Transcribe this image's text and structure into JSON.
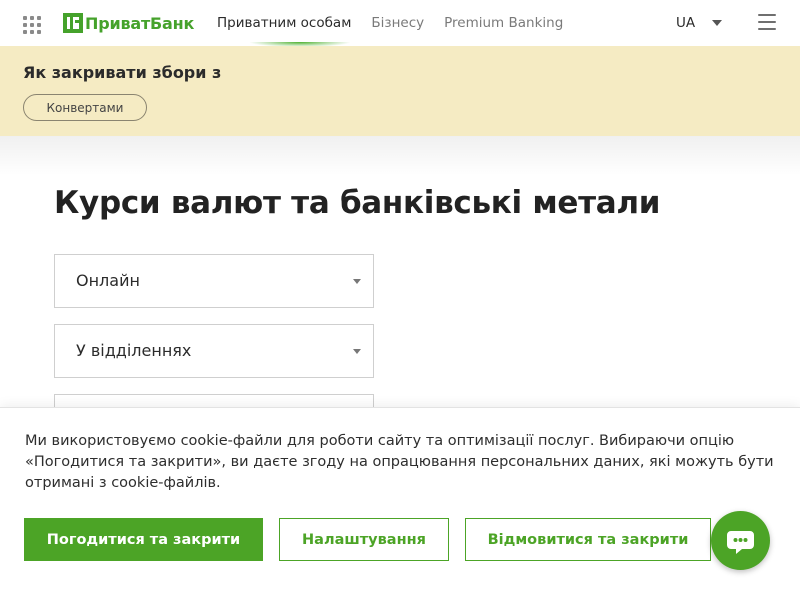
{
  "header": {
    "brand": "ПриватБанк",
    "nav": [
      {
        "label": "Приватним особам",
        "active": true
      },
      {
        "label": "Бізнесу",
        "active": false
      },
      {
        "label": "Premium Banking",
        "active": false
      }
    ],
    "language": "UA",
    "icons": {
      "apps": "grid-icon",
      "menu": "hamburger-icon",
      "lang_toggle": "chevron-down-icon"
    }
  },
  "banner": {
    "title": "Як закривати збори з",
    "pill": "Конвертами",
    "background": "#f5ebc3"
  },
  "main": {
    "title": "Курси валют та банківські метали",
    "dropdowns": [
      {
        "label": "Онлайн"
      },
      {
        "label": "У відділеннях"
      },
      {
        "label": ""
      }
    ]
  },
  "cookie": {
    "text": "Ми використовуємо cookie-файли для роботи сайту та оптимізації послуг. Вибираючи опцію «Погодитися та закрити», ви даєте згоду на опрацювання персональних даних, які можуть бути отримані з cookie-файлів.",
    "accept_label": "Погодитися та закрити",
    "settings_label": "Налаштування",
    "decline_label": "Відмовитися та закрити"
  },
  "chat": {
    "icon": "chat-icon"
  },
  "colors": {
    "brand_green": "#4ca426",
    "text": "#222222",
    "border": "#cfcfcf"
  }
}
